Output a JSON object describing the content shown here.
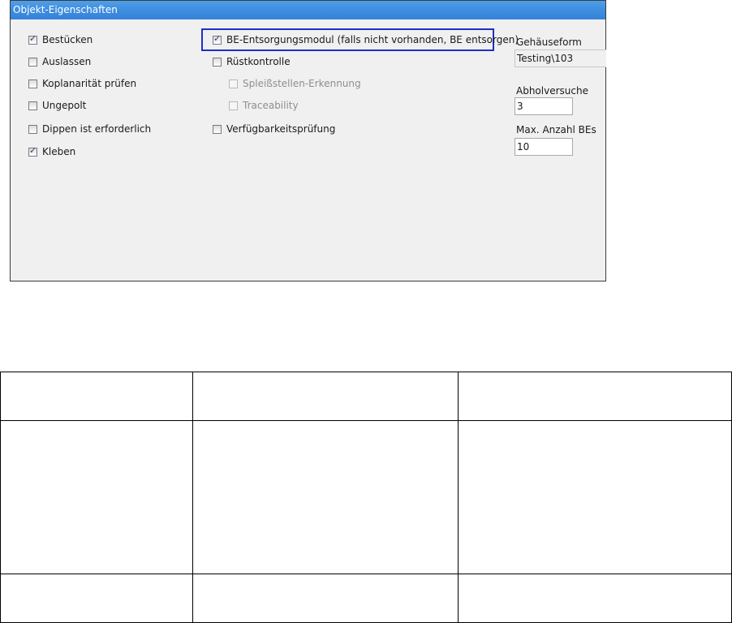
{
  "dialog": {
    "title": "Objekt-Eigenschaften",
    "left_options": [
      {
        "label": "Bestücken",
        "checked": true
      },
      {
        "label": "Auslassen",
        "checked": false
      },
      {
        "label": "Koplanarität prüfen",
        "checked": false
      },
      {
        "label": "Ungepolt",
        "checked": false
      },
      {
        "label": "Dippen ist erforderlich",
        "checked": false
      },
      {
        "label": "Kleben",
        "checked": true
      }
    ],
    "middle_options": [
      {
        "label": "BE-Entsorgungsmodul (falls nicht vorhanden, BE entsorgen)",
        "checked": true,
        "highlighted": true
      },
      {
        "label": "Rüstkontrolle",
        "checked": false
      },
      {
        "label": "Spleißstellen-Erkennung",
        "checked": false,
        "disabled": true
      },
      {
        "label": "Traceability",
        "checked": false,
        "disabled": true
      },
      {
        "label": "Verfügbarkeitsprüfung",
        "checked": false
      }
    ],
    "fields": {
      "housing_label": "Gehäuseform",
      "housing_value": "Testing\\103",
      "pick_attempts_label": "Abholversuche",
      "pick_attempts_value": "3",
      "max_components_label": "Max. Anzahl BEs",
      "max_components_value": "10"
    },
    "colors": {
      "titlebar": "#3f8de0",
      "highlight_border": "#1f2fc8",
      "panel_bg": "#f0f0f0"
    }
  },
  "empty_table": {
    "rows": 3,
    "columns": 3
  }
}
